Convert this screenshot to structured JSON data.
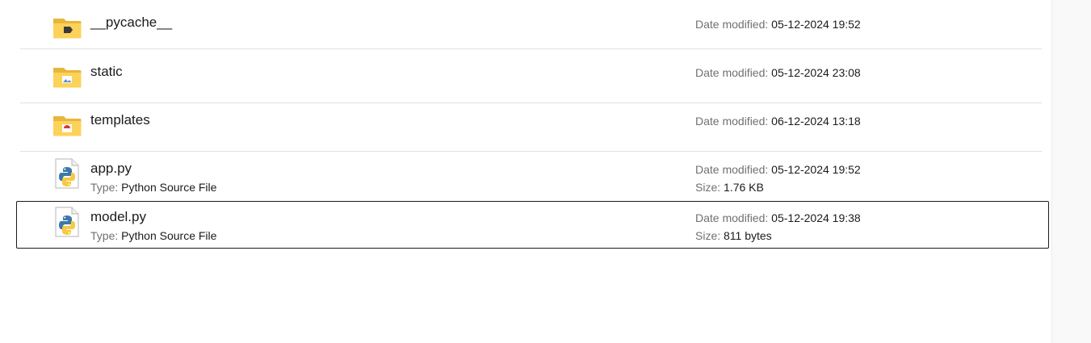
{
  "items": [
    {
      "name": "__pycache__",
      "kind": "folder",
      "emblem": "pycache-emblem",
      "date_label": "Date modified:",
      "date_value": "05-12-2024 19:52"
    },
    {
      "name": "static",
      "kind": "folder",
      "emblem": "image-emblem",
      "date_label": "Date modified:",
      "date_value": "05-12-2024 23:08"
    },
    {
      "name": "templates",
      "kind": "folder",
      "emblem": "web-emblem",
      "date_label": "Date modified:",
      "date_value": "06-12-2024 13:18"
    },
    {
      "name": "app.py",
      "kind": "python-file",
      "type_label": "Type:",
      "type_value": "Python Source File",
      "date_label": "Date modified:",
      "date_value": "05-12-2024 19:52",
      "size_label": "Size:",
      "size_value": "1.76 KB"
    },
    {
      "name": "model.py",
      "kind": "python-file",
      "selected": true,
      "type_label": "Type:",
      "type_value": "Python Source File",
      "date_label": "Date modified:",
      "date_value": "05-12-2024 19:38",
      "size_label": "Size:",
      "size_value": "811 bytes"
    }
  ],
  "colors": {
    "folder_back": "#e8b63c",
    "folder_front": "#fcd25a",
    "divider": "#e1e1e1",
    "selection_border": "#1a1a1a",
    "label_gray": "#707070",
    "text": "#1b1b1b",
    "python_blue": "#3d78aa",
    "python_yellow": "#f7c93f"
  }
}
